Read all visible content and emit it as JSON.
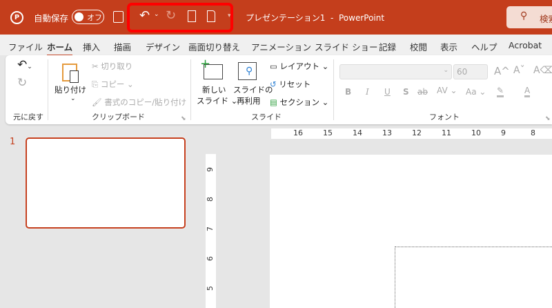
{
  "titlebar": {
    "autosave_label": "自動保存",
    "autosave_state": "オフ",
    "doc_title": "プレゼンテーション1  -  PowerPoint",
    "search_placeholder": "検索"
  },
  "tabs": [
    "ファイル",
    "ホーム",
    "挿入",
    "描画",
    "デザイン",
    "画面切り替え",
    "アニメーション",
    "スライド ショー",
    "記録",
    "校閲",
    "表示",
    "ヘルプ",
    "Acrobat"
  ],
  "ribbon": {
    "undo_group": "元に戻す",
    "clipboard": {
      "paste": "貼り付け",
      "cut": "切り取り",
      "copy": "コピー",
      "format_painter": "書式のコピー/貼り付け",
      "label": "クリップボード"
    },
    "slides": {
      "new_slide_1": "新しい",
      "new_slide_2": "スライド",
      "reuse_1": "スライドの",
      "reuse_2": "再利用",
      "layout": "レイアウト",
      "reset": "リセット",
      "section": "セクション",
      "label": "スライド"
    },
    "font": {
      "font_size": "60",
      "bold": "B",
      "italic": "I",
      "underline": "U",
      "shadow": "S",
      "strike": "ab",
      "spacing": "AV",
      "case": "Aa",
      "label": "フォント"
    }
  },
  "slide_panel": {
    "slide_number": "1"
  },
  "hruler": [
    "16",
    "15",
    "14",
    "13",
    "12",
    "11",
    "10",
    "9",
    "8"
  ],
  "vruler": [
    "9",
    "8",
    "7",
    "6",
    "5"
  ]
}
